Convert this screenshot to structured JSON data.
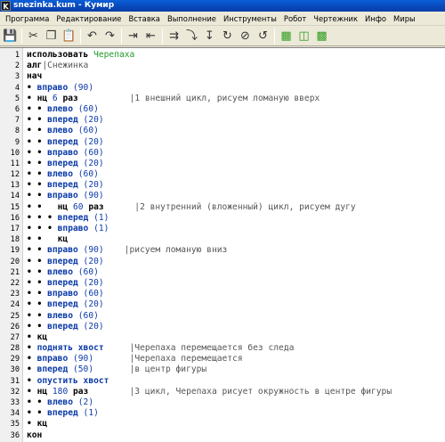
{
  "window": {
    "title": "snezinka.kum - Кумир",
    "icon_letter": "K"
  },
  "menu": [
    "Программа",
    "Редактирование",
    "Вставка",
    "Выполнение",
    "Инструменты",
    "Робот",
    "Чертежник",
    "Инфо",
    "Миры"
  ],
  "toolbar": [
    {
      "name": "save-icon",
      "glyph": "💾"
    },
    {
      "name": "cut-icon",
      "glyph": "✂"
    },
    {
      "name": "copy-icon",
      "glyph": "❐"
    },
    {
      "name": "paste-icon",
      "glyph": "📋"
    },
    {
      "name": "undo-icon",
      "glyph": "↶"
    },
    {
      "name": "redo-icon",
      "glyph": "↷"
    },
    {
      "name": "indent-icon",
      "glyph": "⇥"
    },
    {
      "name": "outdent-icon",
      "glyph": "⇤"
    },
    {
      "name": "run-icon",
      "glyph": "⇉"
    },
    {
      "name": "step-icon",
      "glyph": "⤵"
    },
    {
      "name": "step-into-icon",
      "glyph": "↧"
    },
    {
      "name": "step-over-icon",
      "glyph": "↻"
    },
    {
      "name": "stop-icon",
      "glyph": "⊘"
    },
    {
      "name": "step-out-icon",
      "glyph": "↺"
    },
    {
      "name": "grid-icon",
      "glyph": "▦"
    },
    {
      "name": "robot-window-icon",
      "glyph": "◫"
    },
    {
      "name": "draw-window-icon",
      "glyph": "▩"
    }
  ],
  "code_lines": [
    {
      "n": "1",
      "parts": [
        {
          "t": "использовать ",
          "c": "kw"
        },
        {
          "t": "Черепаха",
          "c": "id"
        }
      ]
    },
    {
      "n": "2",
      "parts": [
        {
          "t": "алг",
          "c": "kw"
        },
        {
          "t": "|Снежинка",
          "c": "cmt"
        }
      ]
    },
    {
      "n": "3",
      "parts": [
        {
          "t": "нач",
          "c": "kw"
        }
      ]
    },
    {
      "n": "4",
      "parts": [
        {
          "t": "• ",
          "c": "dots"
        },
        {
          "t": "вправо ",
          "c": "cmd"
        },
        {
          "t": "(90)",
          "c": "num"
        }
      ]
    },
    {
      "n": "5",
      "parts": [
        {
          "t": "• ",
          "c": "dots"
        },
        {
          "t": "нц ",
          "c": "kw"
        },
        {
          "t": "6 ",
          "c": "num"
        },
        {
          "t": "раз",
          "c": "kw"
        },
        {
          "t": "          |1 внешний цикл, рисуем ломаную вверх",
          "c": "cmt"
        }
      ]
    },
    {
      "n": "6",
      "parts": [
        {
          "t": "• • ",
          "c": "dots"
        },
        {
          "t": "влево ",
          "c": "cmd"
        },
        {
          "t": "(60)",
          "c": "num"
        }
      ]
    },
    {
      "n": "7",
      "parts": [
        {
          "t": "• • ",
          "c": "dots"
        },
        {
          "t": "вперед ",
          "c": "cmd"
        },
        {
          "t": "(20)",
          "c": "num"
        }
      ]
    },
    {
      "n": "8",
      "parts": [
        {
          "t": "• • ",
          "c": "dots"
        },
        {
          "t": "влево ",
          "c": "cmd"
        },
        {
          "t": "(60)",
          "c": "num"
        }
      ]
    },
    {
      "n": "9",
      "parts": [
        {
          "t": "• • ",
          "c": "dots"
        },
        {
          "t": "вперед ",
          "c": "cmd"
        },
        {
          "t": "(20)",
          "c": "num"
        }
      ]
    },
    {
      "n": "10",
      "parts": [
        {
          "t": "• • ",
          "c": "dots"
        },
        {
          "t": "вправо ",
          "c": "cmd"
        },
        {
          "t": "(60)",
          "c": "num"
        }
      ]
    },
    {
      "n": "11",
      "parts": [
        {
          "t": "• • ",
          "c": "dots"
        },
        {
          "t": "вперед ",
          "c": "cmd"
        },
        {
          "t": "(20)",
          "c": "num"
        }
      ]
    },
    {
      "n": "12",
      "parts": [
        {
          "t": "• • ",
          "c": "dots"
        },
        {
          "t": "влево ",
          "c": "cmd"
        },
        {
          "t": "(60)",
          "c": "num"
        }
      ]
    },
    {
      "n": "13",
      "parts": [
        {
          "t": "• • ",
          "c": "dots"
        },
        {
          "t": "вперед ",
          "c": "cmd"
        },
        {
          "t": "(20)",
          "c": "num"
        }
      ]
    },
    {
      "n": "14",
      "parts": [
        {
          "t": "• • ",
          "c": "dots"
        },
        {
          "t": "вправо ",
          "c": "cmd"
        },
        {
          "t": "(90)",
          "c": "num"
        }
      ]
    },
    {
      "n": "15",
      "parts": [
        {
          "t": "• •   ",
          "c": "dots"
        },
        {
          "t": "нц ",
          "c": "kw"
        },
        {
          "t": "60 ",
          "c": "num"
        },
        {
          "t": "раз",
          "c": "kw"
        },
        {
          "t": "      |2 внутренний (вложенный) цикл, рисуем дугу",
          "c": "cmt"
        }
      ]
    },
    {
      "n": "16",
      "parts": [
        {
          "t": "• • • ",
          "c": "dots"
        },
        {
          "t": "вперед ",
          "c": "cmd"
        },
        {
          "t": "(1)",
          "c": "num"
        }
      ]
    },
    {
      "n": "17",
      "parts": [
        {
          "t": "• • • ",
          "c": "dots"
        },
        {
          "t": "вправо ",
          "c": "cmd"
        },
        {
          "t": "(1)",
          "c": "num"
        }
      ]
    },
    {
      "n": "18",
      "parts": [
        {
          "t": "• •   ",
          "c": "dots"
        },
        {
          "t": "кц",
          "c": "kw"
        }
      ]
    },
    {
      "n": "19",
      "parts": [
        {
          "t": "• • ",
          "c": "dots"
        },
        {
          "t": "вправо ",
          "c": "cmd"
        },
        {
          "t": "(90)",
          "c": "num"
        },
        {
          "t": "    |рисуем ломаную вниз",
          "c": "cmt"
        }
      ]
    },
    {
      "n": "20",
      "parts": [
        {
          "t": "• • ",
          "c": "dots"
        },
        {
          "t": "вперед ",
          "c": "cmd"
        },
        {
          "t": "(20)",
          "c": "num"
        }
      ]
    },
    {
      "n": "21",
      "parts": [
        {
          "t": "• • ",
          "c": "dots"
        },
        {
          "t": "влево ",
          "c": "cmd"
        },
        {
          "t": "(60)",
          "c": "num"
        }
      ]
    },
    {
      "n": "22",
      "parts": [
        {
          "t": "• • ",
          "c": "dots"
        },
        {
          "t": "вперед ",
          "c": "cmd"
        },
        {
          "t": "(20)",
          "c": "num"
        }
      ]
    },
    {
      "n": "23",
      "parts": [
        {
          "t": "• • ",
          "c": "dots"
        },
        {
          "t": "вправо ",
          "c": "cmd"
        },
        {
          "t": "(60)",
          "c": "num"
        }
      ]
    },
    {
      "n": "24",
      "parts": [
        {
          "t": "• • ",
          "c": "dots"
        },
        {
          "t": "вперед ",
          "c": "cmd"
        },
        {
          "t": "(20)",
          "c": "num"
        }
      ]
    },
    {
      "n": "25",
      "parts": [
        {
          "t": "• • ",
          "c": "dots"
        },
        {
          "t": "влево ",
          "c": "cmd"
        },
        {
          "t": "(60)",
          "c": "num"
        }
      ]
    },
    {
      "n": "26",
      "parts": [
        {
          "t": "• • ",
          "c": "dots"
        },
        {
          "t": "вперед ",
          "c": "cmd"
        },
        {
          "t": "(20)",
          "c": "num"
        }
      ]
    },
    {
      "n": "27",
      "parts": [
        {
          "t": "• ",
          "c": "dots"
        },
        {
          "t": "кц",
          "c": "kw"
        }
      ]
    },
    {
      "n": "28",
      "parts": [
        {
          "t": "• ",
          "c": "dots"
        },
        {
          "t": "поднять хвост",
          "c": "cmd"
        },
        {
          "t": "     |Черепаха перемещается без следа",
          "c": "cmt"
        }
      ]
    },
    {
      "n": "29",
      "parts": [
        {
          "t": "• ",
          "c": "dots"
        },
        {
          "t": "вправо ",
          "c": "cmd"
        },
        {
          "t": "(90)",
          "c": "num"
        },
        {
          "t": "       |Черепаха перемещается",
          "c": "cmt"
        }
      ]
    },
    {
      "n": "30",
      "parts": [
        {
          "t": "• ",
          "c": "dots"
        },
        {
          "t": "вперед ",
          "c": "cmd"
        },
        {
          "t": "(50)",
          "c": "num"
        },
        {
          "t": "       |в центр фигуры",
          "c": "cmt"
        }
      ]
    },
    {
      "n": "31",
      "parts": [
        {
          "t": "• ",
          "c": "dots"
        },
        {
          "t": "опустить хвост",
          "c": "cmd"
        }
      ]
    },
    {
      "n": "32",
      "parts": [
        {
          "t": "• ",
          "c": "dots"
        },
        {
          "t": "нц ",
          "c": "kw"
        },
        {
          "t": "180 ",
          "c": "num"
        },
        {
          "t": "раз",
          "c": "kw"
        },
        {
          "t": "        |3 цикл, Черепаха рисует окружность в центре фигуры",
          "c": "cmt"
        }
      ]
    },
    {
      "n": "33",
      "parts": [
        {
          "t": "• • ",
          "c": "dots"
        },
        {
          "t": "влево ",
          "c": "cmd"
        },
        {
          "t": "(2)",
          "c": "num"
        }
      ]
    },
    {
      "n": "34",
      "parts": [
        {
          "t": "• • ",
          "c": "dots"
        },
        {
          "t": "вперед ",
          "c": "cmd"
        },
        {
          "t": "(1)",
          "c": "num"
        }
      ]
    },
    {
      "n": "35",
      "parts": [
        {
          "t": "• ",
          "c": "dots"
        },
        {
          "t": "кц",
          "c": "kw"
        }
      ]
    },
    {
      "n": "36",
      "parts": [
        {
          "t": "кон",
          "c": "kw"
        }
      ]
    }
  ]
}
